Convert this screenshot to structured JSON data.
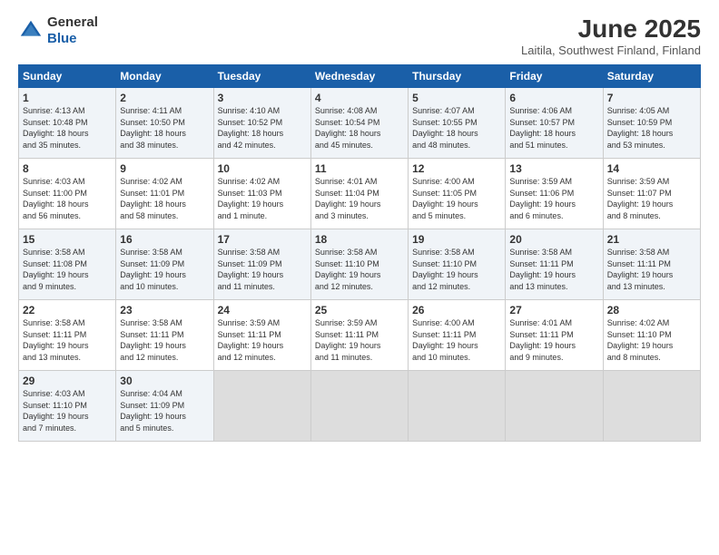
{
  "header": {
    "logo": {
      "general": "General",
      "blue": "Blue"
    },
    "title": "June 2025",
    "location": "Laitila, Southwest Finland, Finland"
  },
  "days_of_week": [
    "Sunday",
    "Monday",
    "Tuesday",
    "Wednesday",
    "Thursday",
    "Friday",
    "Saturday"
  ],
  "weeks": [
    [
      {
        "day": "1",
        "info": "Sunrise: 4:13 AM\nSunset: 10:48 PM\nDaylight: 18 hours\nand 35 minutes."
      },
      {
        "day": "2",
        "info": "Sunrise: 4:11 AM\nSunset: 10:50 PM\nDaylight: 18 hours\nand 38 minutes."
      },
      {
        "day": "3",
        "info": "Sunrise: 4:10 AM\nSunset: 10:52 PM\nDaylight: 18 hours\nand 42 minutes."
      },
      {
        "day": "4",
        "info": "Sunrise: 4:08 AM\nSunset: 10:54 PM\nDaylight: 18 hours\nand 45 minutes."
      },
      {
        "day": "5",
        "info": "Sunrise: 4:07 AM\nSunset: 10:55 PM\nDaylight: 18 hours\nand 48 minutes."
      },
      {
        "day": "6",
        "info": "Sunrise: 4:06 AM\nSunset: 10:57 PM\nDaylight: 18 hours\nand 51 minutes."
      },
      {
        "day": "7",
        "info": "Sunrise: 4:05 AM\nSunset: 10:59 PM\nDaylight: 18 hours\nand 53 minutes."
      }
    ],
    [
      {
        "day": "8",
        "info": "Sunrise: 4:03 AM\nSunset: 11:00 PM\nDaylight: 18 hours\nand 56 minutes."
      },
      {
        "day": "9",
        "info": "Sunrise: 4:02 AM\nSunset: 11:01 PM\nDaylight: 18 hours\nand 58 minutes."
      },
      {
        "day": "10",
        "info": "Sunrise: 4:02 AM\nSunset: 11:03 PM\nDaylight: 19 hours\nand 1 minute."
      },
      {
        "day": "11",
        "info": "Sunrise: 4:01 AM\nSunset: 11:04 PM\nDaylight: 19 hours\nand 3 minutes."
      },
      {
        "day": "12",
        "info": "Sunrise: 4:00 AM\nSunset: 11:05 PM\nDaylight: 19 hours\nand 5 minutes."
      },
      {
        "day": "13",
        "info": "Sunrise: 3:59 AM\nSunset: 11:06 PM\nDaylight: 19 hours\nand 6 minutes."
      },
      {
        "day": "14",
        "info": "Sunrise: 3:59 AM\nSunset: 11:07 PM\nDaylight: 19 hours\nand 8 minutes."
      }
    ],
    [
      {
        "day": "15",
        "info": "Sunrise: 3:58 AM\nSunset: 11:08 PM\nDaylight: 19 hours\nand 9 minutes."
      },
      {
        "day": "16",
        "info": "Sunrise: 3:58 AM\nSunset: 11:09 PM\nDaylight: 19 hours\nand 10 minutes."
      },
      {
        "day": "17",
        "info": "Sunrise: 3:58 AM\nSunset: 11:09 PM\nDaylight: 19 hours\nand 11 minutes."
      },
      {
        "day": "18",
        "info": "Sunrise: 3:58 AM\nSunset: 11:10 PM\nDaylight: 19 hours\nand 12 minutes."
      },
      {
        "day": "19",
        "info": "Sunrise: 3:58 AM\nSunset: 11:10 PM\nDaylight: 19 hours\nand 12 minutes."
      },
      {
        "day": "20",
        "info": "Sunrise: 3:58 AM\nSunset: 11:11 PM\nDaylight: 19 hours\nand 13 minutes."
      },
      {
        "day": "21",
        "info": "Sunrise: 3:58 AM\nSunset: 11:11 PM\nDaylight: 19 hours\nand 13 minutes."
      }
    ],
    [
      {
        "day": "22",
        "info": "Sunrise: 3:58 AM\nSunset: 11:11 PM\nDaylight: 19 hours\nand 13 minutes."
      },
      {
        "day": "23",
        "info": "Sunrise: 3:58 AM\nSunset: 11:11 PM\nDaylight: 19 hours\nand 12 minutes."
      },
      {
        "day": "24",
        "info": "Sunrise: 3:59 AM\nSunset: 11:11 PM\nDaylight: 19 hours\nand 12 minutes."
      },
      {
        "day": "25",
        "info": "Sunrise: 3:59 AM\nSunset: 11:11 PM\nDaylight: 19 hours\nand 11 minutes."
      },
      {
        "day": "26",
        "info": "Sunrise: 4:00 AM\nSunset: 11:11 PM\nDaylight: 19 hours\nand 10 minutes."
      },
      {
        "day": "27",
        "info": "Sunrise: 4:01 AM\nSunset: 11:11 PM\nDaylight: 19 hours\nand 9 minutes."
      },
      {
        "day": "28",
        "info": "Sunrise: 4:02 AM\nSunset: 11:10 PM\nDaylight: 19 hours\nand 8 minutes."
      }
    ],
    [
      {
        "day": "29",
        "info": "Sunrise: 4:03 AM\nSunset: 11:10 PM\nDaylight: 19 hours\nand 7 minutes."
      },
      {
        "day": "30",
        "info": "Sunrise: 4:04 AM\nSunset: 11:09 PM\nDaylight: 19 hours\nand 5 minutes."
      },
      null,
      null,
      null,
      null,
      null
    ]
  ]
}
